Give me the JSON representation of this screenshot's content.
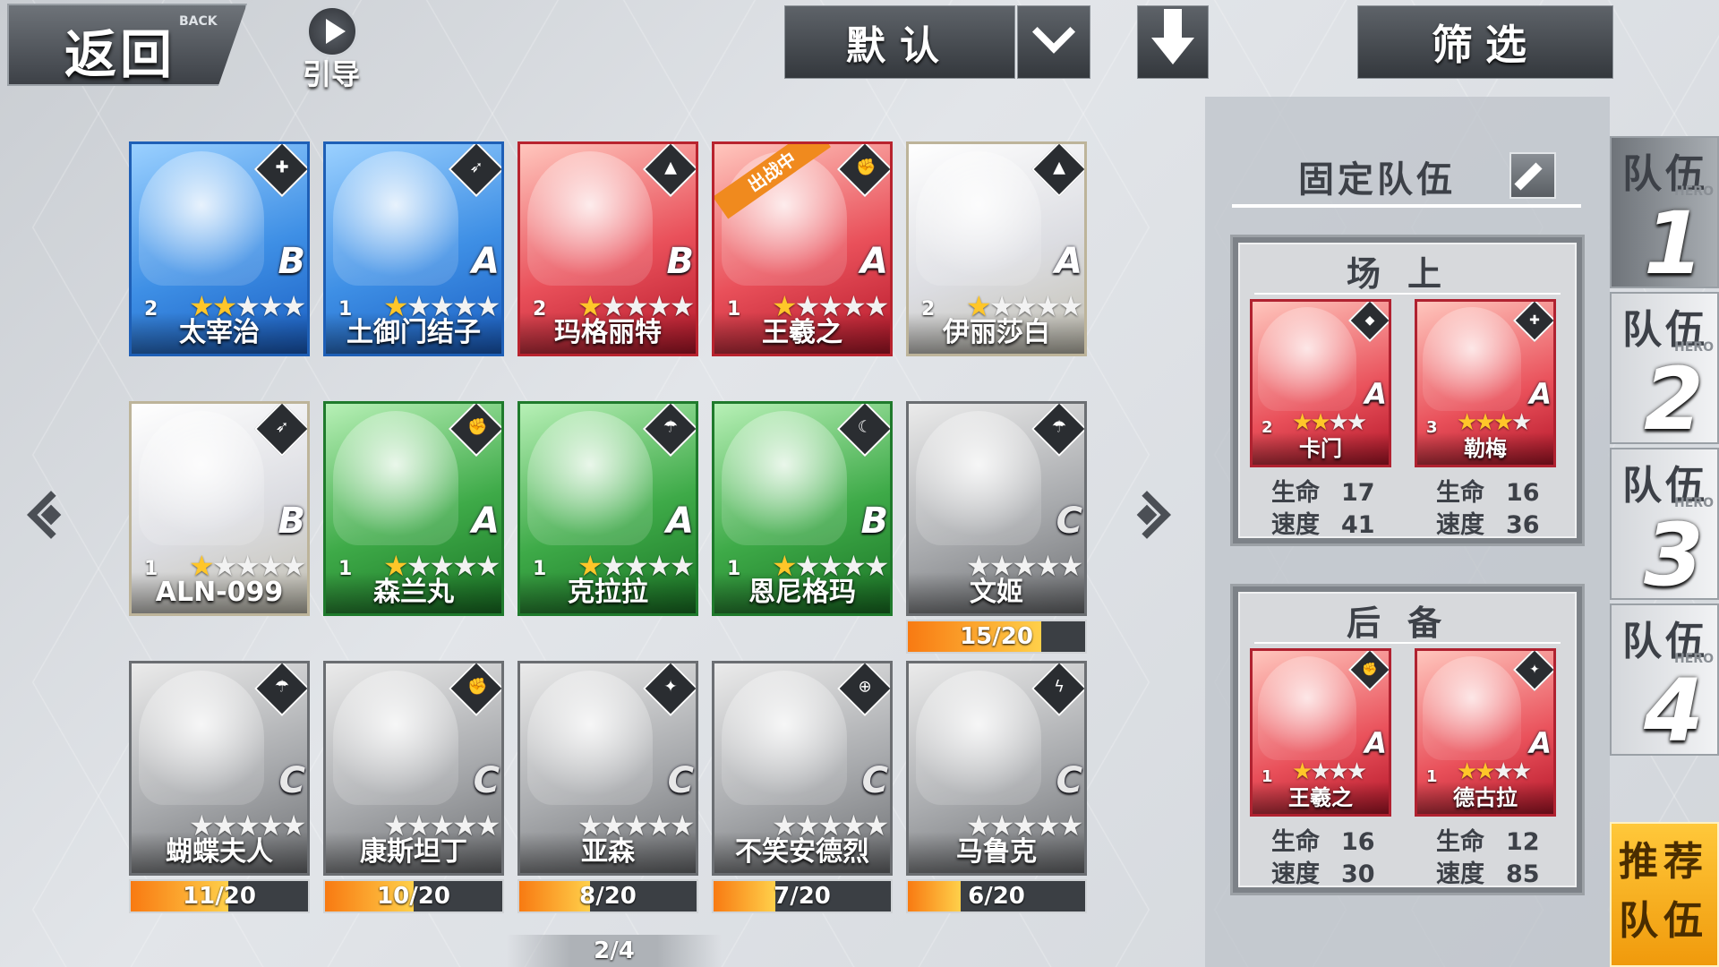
{
  "top": {
    "back_label": "返回",
    "back_sub": "BACK",
    "guide_label": "引导",
    "sort_label": "默认",
    "filter_label": "筛选"
  },
  "roster": [
    {
      "name": "太宰治",
      "level": "2",
      "stars": 2,
      "rank": "B",
      "color": "blue",
      "type_icon": "cross-icon",
      "type_glyph": "✚"
    },
    {
      "name": "土御门结子",
      "level": "1",
      "stars": 1,
      "rank": "A",
      "color": "blue",
      "type_icon": "bow-icon",
      "type_glyph": "➶"
    },
    {
      "name": "玛格丽特",
      "level": "2",
      "stars": 1,
      "rank": "B",
      "color": "red",
      "type_icon": "arrow-icon",
      "type_glyph": "▲"
    },
    {
      "name": "王羲之",
      "level": "1",
      "stars": 1,
      "rank": "A",
      "color": "red",
      "type_icon": "fist-icon",
      "type_glyph": "✊",
      "badge": "出战中"
    },
    {
      "name": "伊丽莎白",
      "level": "2",
      "stars": 1,
      "rank": "A",
      "color": "white",
      "type_icon": "arrow-icon",
      "type_glyph": "▲"
    },
    {
      "name": "ALN-099",
      "level": "1",
      "stars": 1,
      "rank": "B",
      "color": "white",
      "type_icon": "bow-icon",
      "type_glyph": "➶"
    },
    {
      "name": "森兰丸",
      "level": "1",
      "stars": 1,
      "rank": "A",
      "color": "green",
      "type_icon": "fist-icon",
      "type_glyph": "✊"
    },
    {
      "name": "克拉拉",
      "level": "1",
      "stars": 1,
      "rank": "A",
      "color": "green",
      "type_icon": "umbrella-icon",
      "type_glyph": "☂"
    },
    {
      "name": "恩尼格玛",
      "level": "1",
      "stars": 1,
      "rank": "B",
      "color": "green",
      "type_icon": "sickle-icon",
      "type_glyph": "☾"
    },
    {
      "name": "文姬",
      "level": "",
      "stars": 0,
      "rank": "C",
      "color": "gray",
      "type_icon": "umbrella-icon",
      "type_glyph": "☂",
      "progress": "15/20",
      "progress_value": 0.75
    },
    {
      "name": "蝴蝶夫人",
      "level": "",
      "stars": 0,
      "rank": "C",
      "color": "gray",
      "type_icon": "umbrella-icon",
      "type_glyph": "☂",
      "progress": "11/20",
      "progress_value": 0.55
    },
    {
      "name": "康斯坦丁",
      "level": "",
      "stars": 0,
      "rank": "C",
      "color": "gray",
      "type_icon": "fist-icon",
      "type_glyph": "✊",
      "progress": "10/20",
      "progress_value": 0.5
    },
    {
      "name": "亚森",
      "level": "",
      "stars": 0,
      "rank": "C",
      "color": "gray",
      "type_icon": "shuriken-icon",
      "type_glyph": "✦",
      "progress": "8/20",
      "progress_value": 0.4
    },
    {
      "name": "不笑安德烈",
      "level": "",
      "stars": 0,
      "rank": "C",
      "color": "gray",
      "type_icon": "crosshair-icon",
      "type_glyph": "⊕",
      "progress": "7/20",
      "progress_value": 0.35
    },
    {
      "name": "马鲁克",
      "level": "",
      "stars": 0,
      "rank": "C",
      "color": "gray",
      "type_icon": "dagger-icon",
      "type_glyph": "ϟ",
      "progress": "6/20",
      "progress_value": 0.3
    }
  ],
  "pager": "2/4",
  "team_panel": {
    "title": "固定队伍",
    "onfield_label": "场上",
    "reserve_label": "后备",
    "stat_hp": "生命",
    "stat_speed": "速度",
    "onfield": [
      {
        "name": "卡门",
        "level": "2",
        "stars": 2,
        "rank": "A",
        "type_icon": "mask-icon",
        "type_glyph": "◆",
        "hp": "17",
        "speed": "41"
      },
      {
        "name": "勒梅",
        "level": "3",
        "stars": 3,
        "rank": "A",
        "type_icon": "cross-icon",
        "type_glyph": "✚",
        "hp": "16",
        "speed": "36"
      }
    ],
    "reserve": [
      {
        "name": "王羲之",
        "level": "1",
        "stars": 1,
        "rank": "A",
        "type_icon": "fist-icon",
        "type_glyph": "✊",
        "hp": "16",
        "speed": "30"
      },
      {
        "name": "德古拉",
        "level": "1",
        "stars": 2,
        "rank": "A",
        "type_icon": "shuriken-icon",
        "type_glyph": "✦",
        "hp": "12",
        "speed": "85"
      }
    ]
  },
  "team_tabs": [
    {
      "label": "队伍",
      "num": "1",
      "hero": "HERO"
    },
    {
      "label": "队伍",
      "num": "2",
      "hero": "HERO"
    },
    {
      "label": "队伍",
      "num": "3",
      "hero": "HERO"
    },
    {
      "label": "队伍",
      "num": "4",
      "hero": "HERO"
    }
  ],
  "recommend_label": "推荐队伍"
}
